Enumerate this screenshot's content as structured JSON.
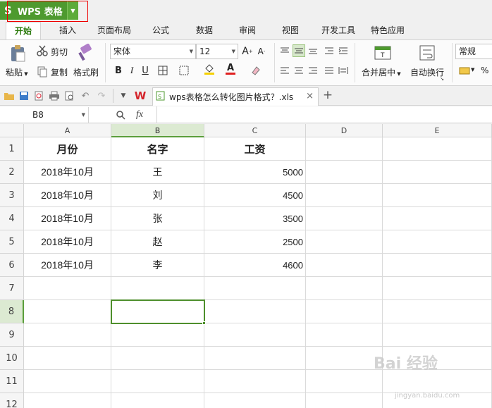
{
  "app": {
    "menu_button_label": "WPS 表格",
    "logo_glyph": "S"
  },
  "tabs": [
    "开始",
    "插入",
    "页面布局",
    "公式",
    "数据",
    "审阅",
    "视图",
    "开发工具",
    "特色应用"
  ],
  "ribbon": {
    "cut_label": "剪切",
    "paste_label": "粘贴",
    "copy_label": "复制",
    "format_painter_label": "格式刷",
    "font_name": "宋体",
    "font_size": "12",
    "merge_center_label": "合并居中",
    "wrap_text_label": "自动换行",
    "number_format": "常规",
    "percent_symbol": "%",
    "bold": "B",
    "italic": "I",
    "underline": "U",
    "font_color_glyph": "A"
  },
  "document_tab": {
    "filename": "wps表格怎么转化图片格式？.xls",
    "close_glyph": "×",
    "new_tab_glyph": "+"
  },
  "formula_bar": {
    "name_box": "B8",
    "fx_label": "fx",
    "content": ""
  },
  "sheet": {
    "columns": [
      "A",
      "B",
      "C",
      "D",
      "E"
    ],
    "selected_column": "B",
    "rows": [
      "1",
      "2",
      "3",
      "4",
      "5",
      "6",
      "7",
      "8",
      "9",
      "10",
      "11",
      "12"
    ],
    "selected_row": "8",
    "headers": [
      "月份",
      "名字",
      "工资"
    ],
    "data": [
      [
        "2018年10月",
        "王",
        "5000"
      ],
      [
        "2018年10月",
        "刘",
        "4500"
      ],
      [
        "2018年10月",
        "张",
        "3500"
      ],
      [
        "2018年10月",
        "赵",
        "2500"
      ],
      [
        "2018年10月",
        "李",
        "4600"
      ]
    ]
  },
  "watermark": {
    "text": "Bai 经验",
    "sub": "jingyan.baidu.com"
  },
  "colors": {
    "accent": "#4e9a2f",
    "selection": "#4e8f2c",
    "header_selected": "#dcead2",
    "highlight_border": "#e00000"
  }
}
